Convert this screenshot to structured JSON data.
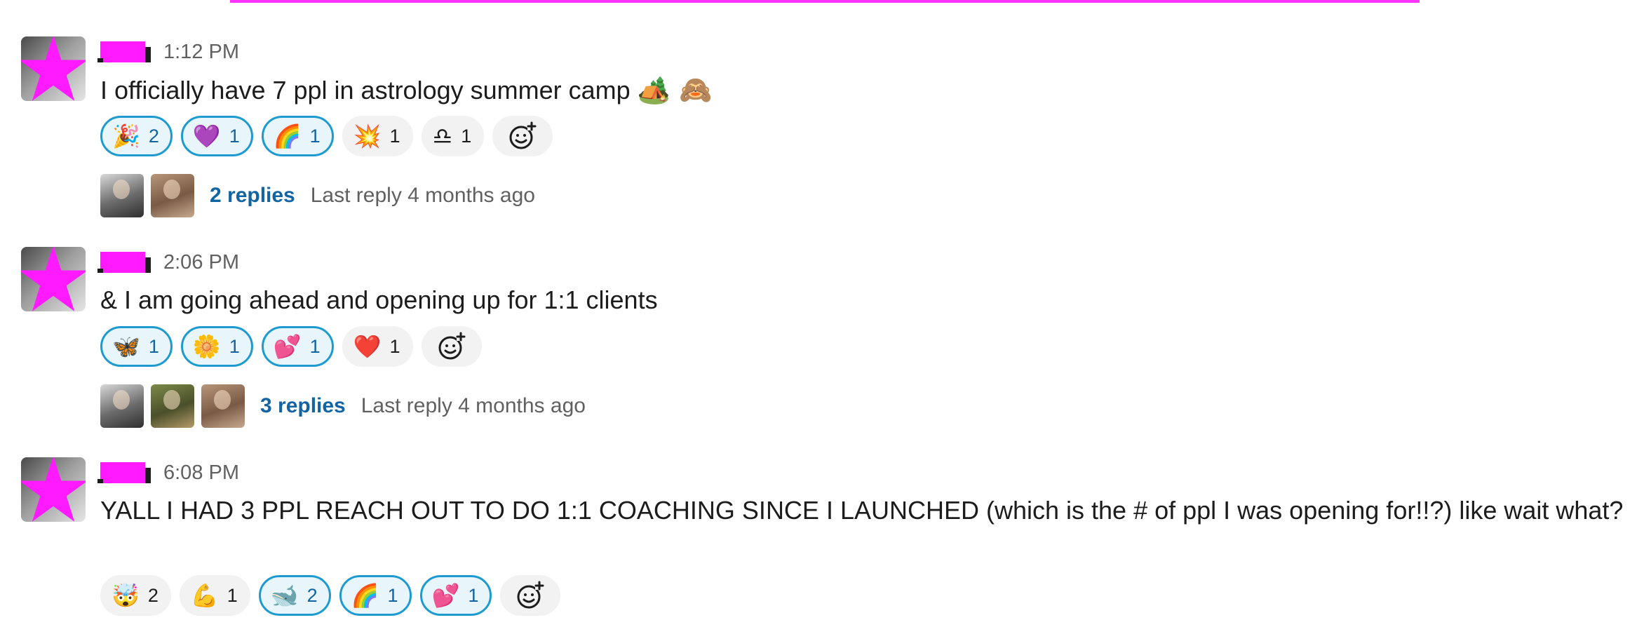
{
  "colors": {
    "redaction": "#ff1aff",
    "reaction_highlight_border": "#1d9bd1",
    "reaction_highlight_bg": "#e8f5fa",
    "link_blue": "#1264a3",
    "timestamp_gray": "#616061"
  },
  "messages": [
    {
      "time": "1:12 PM",
      "text": "I officially have 7 ppl in astrology summer camp",
      "text_emojis": "🏕️ 🙈",
      "reactions": [
        {
          "emoji": "🎉",
          "count": "2",
          "highlighted": true
        },
        {
          "emoji": "💜",
          "count": "1",
          "highlighted": true
        },
        {
          "emoji": "🌈",
          "count": "1",
          "highlighted": true
        },
        {
          "emoji": "💥",
          "count": "1",
          "highlighted": false
        },
        {
          "emoji": "♎",
          "count": "1",
          "highlighted": false
        }
      ],
      "thread": {
        "replies": "2 replies",
        "last_reply": "Last reply 4 months ago"
      }
    },
    {
      "time": "2:06 PM",
      "text": "& I am going ahead and opening up for 1:1 clients",
      "reactions": [
        {
          "emoji": "🦋",
          "count": "1",
          "highlighted": true
        },
        {
          "emoji": "🌼",
          "count": "1",
          "highlighted": true
        },
        {
          "emoji": "💕",
          "count": "1",
          "highlighted": true
        },
        {
          "emoji": "❤️",
          "count": "1",
          "highlighted": false
        }
      ],
      "thread": {
        "replies": "3 replies",
        "last_reply": "Last reply 4 months ago"
      }
    },
    {
      "time": "6:08 PM",
      "text": "YALL I HAD 3 PPL REACH OUT TO DO 1:1 COACHING SINCE I LAUNCHED (which is the # of ppl I was opening for!!?) like wait what?",
      "reactions": [
        {
          "emoji": "🤯",
          "count": "2",
          "highlighted": false
        },
        {
          "emoji": "💪",
          "count": "1",
          "highlighted": false
        },
        {
          "emoji": "🐋",
          "count": "2",
          "highlighted": true
        },
        {
          "emoji": "🌈",
          "count": "1",
          "highlighted": true
        },
        {
          "emoji": "💕",
          "count": "1",
          "highlighted": true
        }
      ]
    }
  ],
  "icons": {
    "avatar_overlay": "star-icon",
    "add_reaction": "add-reaction-icon"
  }
}
